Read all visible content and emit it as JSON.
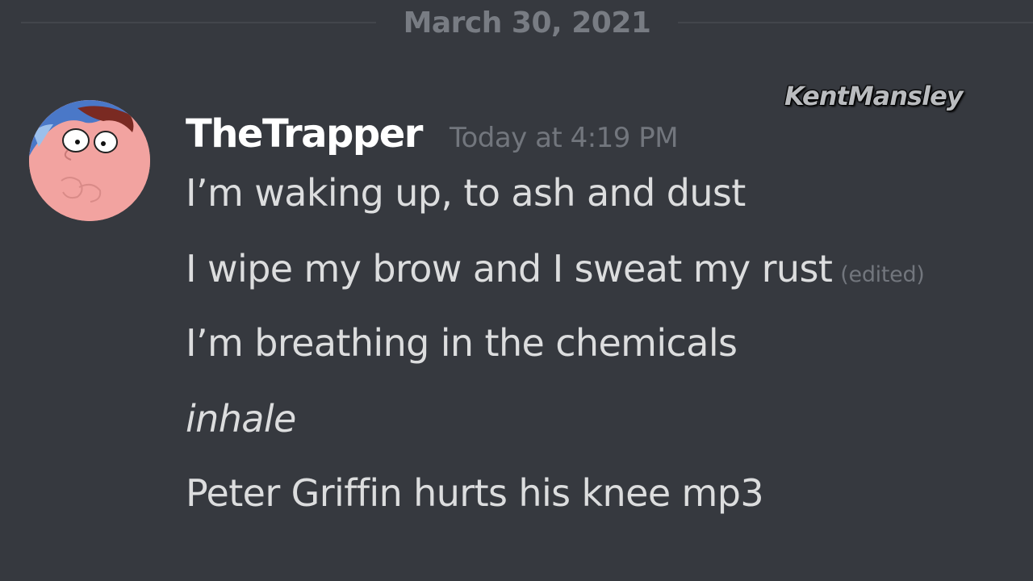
{
  "divider": {
    "date": "March 30, 2021"
  },
  "watermark": "KentMansley",
  "message": {
    "username": "TheTrapper",
    "timestamp": "Today at 4:19 PM",
    "avatar_icon": "peter-griffin-avatar",
    "lines": [
      {
        "text": "I’m waking up, to ash and dust",
        "edited": ""
      },
      {
        "text": "I wipe my brow and I sweat my rust",
        "edited": "(edited)"
      },
      {
        "text": "I’m breathing in the chemicals",
        "edited": ""
      },
      {
        "text": "inhale",
        "edited": "",
        "italic": true
      },
      {
        "text": "Peter Griffin hurts his knee mp3",
        "edited": ""
      }
    ]
  },
  "colors": {
    "background": "#36393f",
    "username": "#ffffff",
    "message_text": "#dcddde",
    "muted_text": "#72767d",
    "avatar_skin": "#f2a3a0"
  }
}
